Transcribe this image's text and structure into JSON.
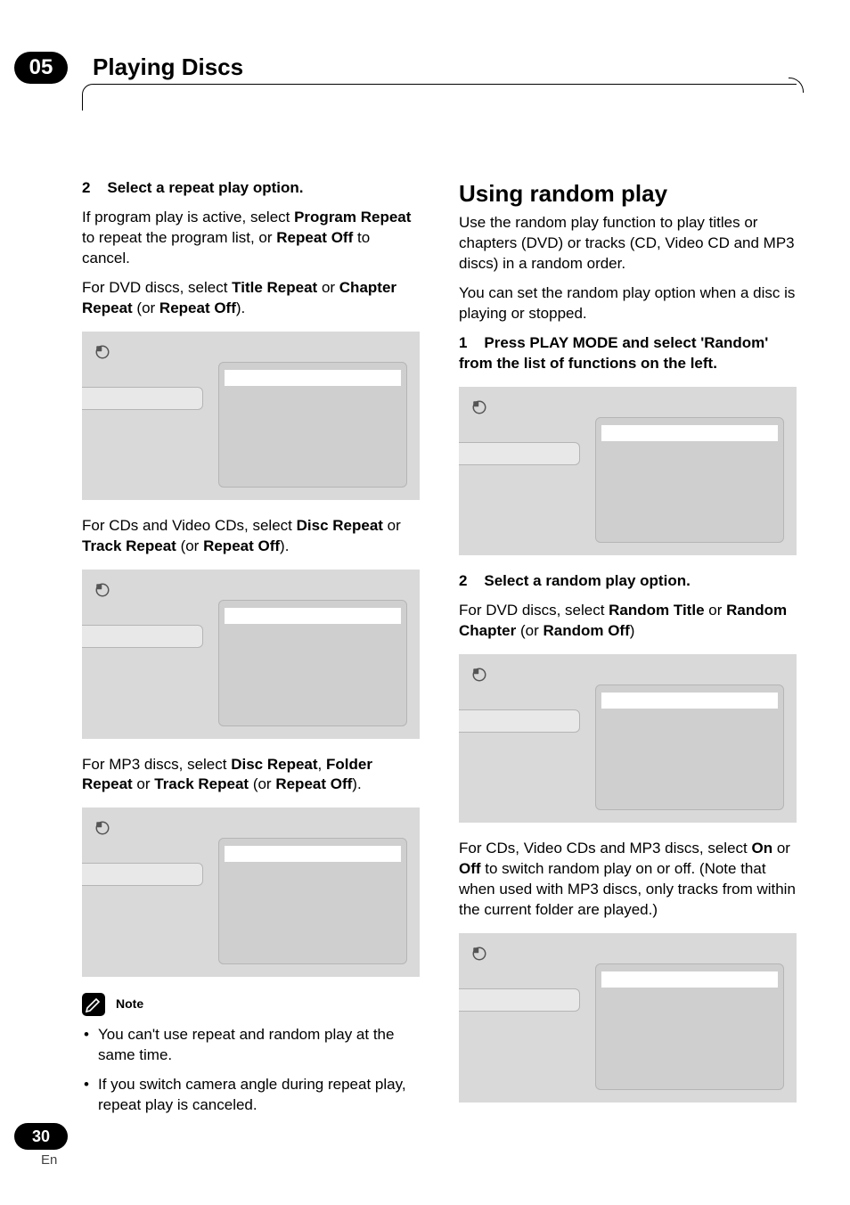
{
  "chapter": {
    "number": "05",
    "title": "Playing Discs"
  },
  "left": {
    "step2_lead_num": "2",
    "step2_lead": "Select a repeat play option.",
    "p1_a": "If program play is active, select ",
    "p1_b": "Program Repeat",
    "p1_c": " to repeat the program list, or ",
    "p1_d": "Repeat Off",
    "p1_e": " to cancel.",
    "p2_a": "For DVD discs, select ",
    "p2_b": "Title Repeat",
    "p2_c": " or ",
    "p2_d": "Chapter Repeat",
    "p2_e": " (or ",
    "p2_f": "Repeat Off",
    "p2_g": ").",
    "p3_a": "For CDs and Video CDs, select ",
    "p3_b": "Disc Repeat",
    "p3_c": " or ",
    "p3_d": "Track Repeat",
    "p3_e": " (or ",
    "p3_f": "Repeat Off",
    "p3_g": ").",
    "p4_a": "For MP3 discs, select ",
    "p4_b": "Disc Repeat",
    "p4_c": ", ",
    "p4_d": "Folder Repeat",
    "p4_e": " or ",
    "p4_f": "Track Repeat",
    "p4_g": " (or ",
    "p4_h": "Repeat Off",
    "p4_i": ").",
    "note_label": "Note",
    "note1": "You can't use repeat and random play at the same time.",
    "note2": "If you switch camera angle during repeat play, repeat play is canceled."
  },
  "right": {
    "heading": "Using random play",
    "intro": "Use the random play function to play titles or chapters (DVD) or tracks (CD, Video CD and MP3 discs) in a random order.",
    "intro2": "You can set the random play option when a disc is playing or stopped.",
    "step1_lead_num": "1",
    "step1_lead": "Press PLAY MODE and select 'Random' from the list of functions on the left.",
    "step2_lead_num": "2",
    "step2_lead": "Select a random play option.",
    "p2_a": "For DVD discs, select ",
    "p2_b": "Random Title",
    "p2_c": " or ",
    "p2_d": "Random Chapter",
    "p2_e": " (or ",
    "p2_f": "Random Off",
    "p2_g": ")",
    "p3_a": "For CDs, Video CDs and MP3 discs, select ",
    "p3_b": "On",
    "p3_c": " or ",
    "p3_d": "Off",
    "p3_e": " to switch random play on or off. (Note that when used with MP3 discs, only tracks from within the current folder are played.)"
  },
  "footer": {
    "page": "30",
    "lang": "En"
  }
}
